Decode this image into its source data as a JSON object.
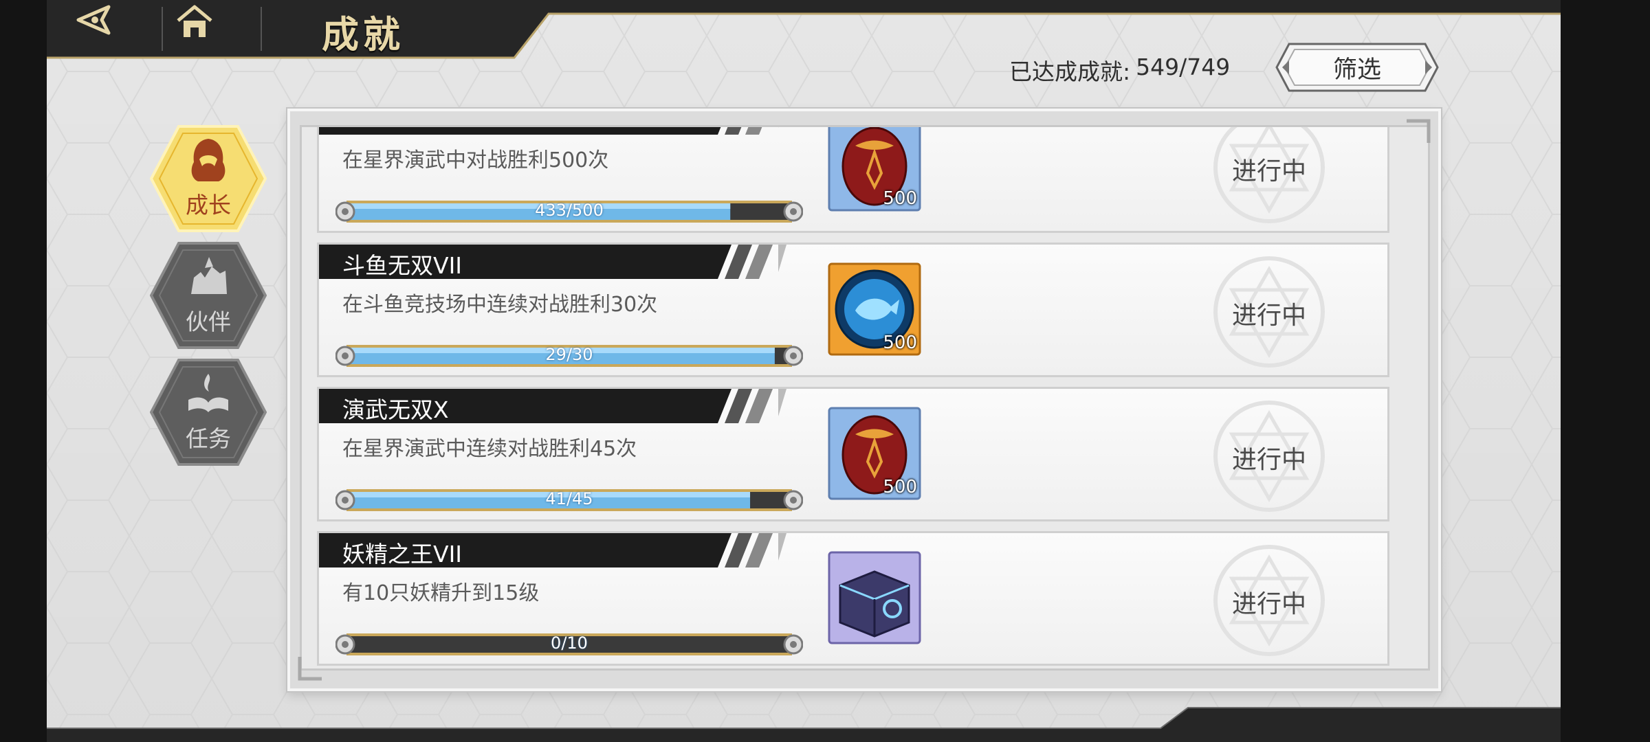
{
  "header": {
    "title": "成就"
  },
  "summary": {
    "label": "已达成成就:",
    "value": "549/749"
  },
  "filter": {
    "label": "筛选"
  },
  "categories": [
    {
      "label": "成长",
      "active": true
    },
    {
      "label": "伙伴",
      "active": false
    },
    {
      "label": "任务",
      "active": false
    }
  ],
  "achievements": [
    {
      "title": "",
      "description": "在星界演武中对战胜利500次",
      "progress_text": "433/500",
      "progress": 0.866,
      "reward_icon": "red-egg-icon",
      "reward_count": "500",
      "status": "进行中"
    },
    {
      "title": "斗鱼无双VII",
      "description": "在斗鱼竞技场中连续对战胜利30次",
      "progress_text": "29/30",
      "progress": 0.967,
      "reward_icon": "blue-fish-orb-icon",
      "reward_count": "500",
      "status": "进行中"
    },
    {
      "title": "演武无双X",
      "description": "在星界演武中连续对战胜利45次",
      "progress_text": "41/45",
      "progress": 0.911,
      "reward_icon": "red-egg-icon",
      "reward_count": "500",
      "status": "进行中"
    },
    {
      "title": "妖精之王VII",
      "description": "有10只妖精升到15级",
      "progress_text": "0/10",
      "progress": 0.0,
      "reward_icon": "treasure-chest-icon",
      "reward_count": "",
      "status": "进行中"
    }
  ],
  "colors": {
    "accent_gold": "#f5d25a",
    "title_gold": "#e8d8a8",
    "progress_blue": "#6fb8e8",
    "title_bar_dark": "#1c1c1c"
  }
}
